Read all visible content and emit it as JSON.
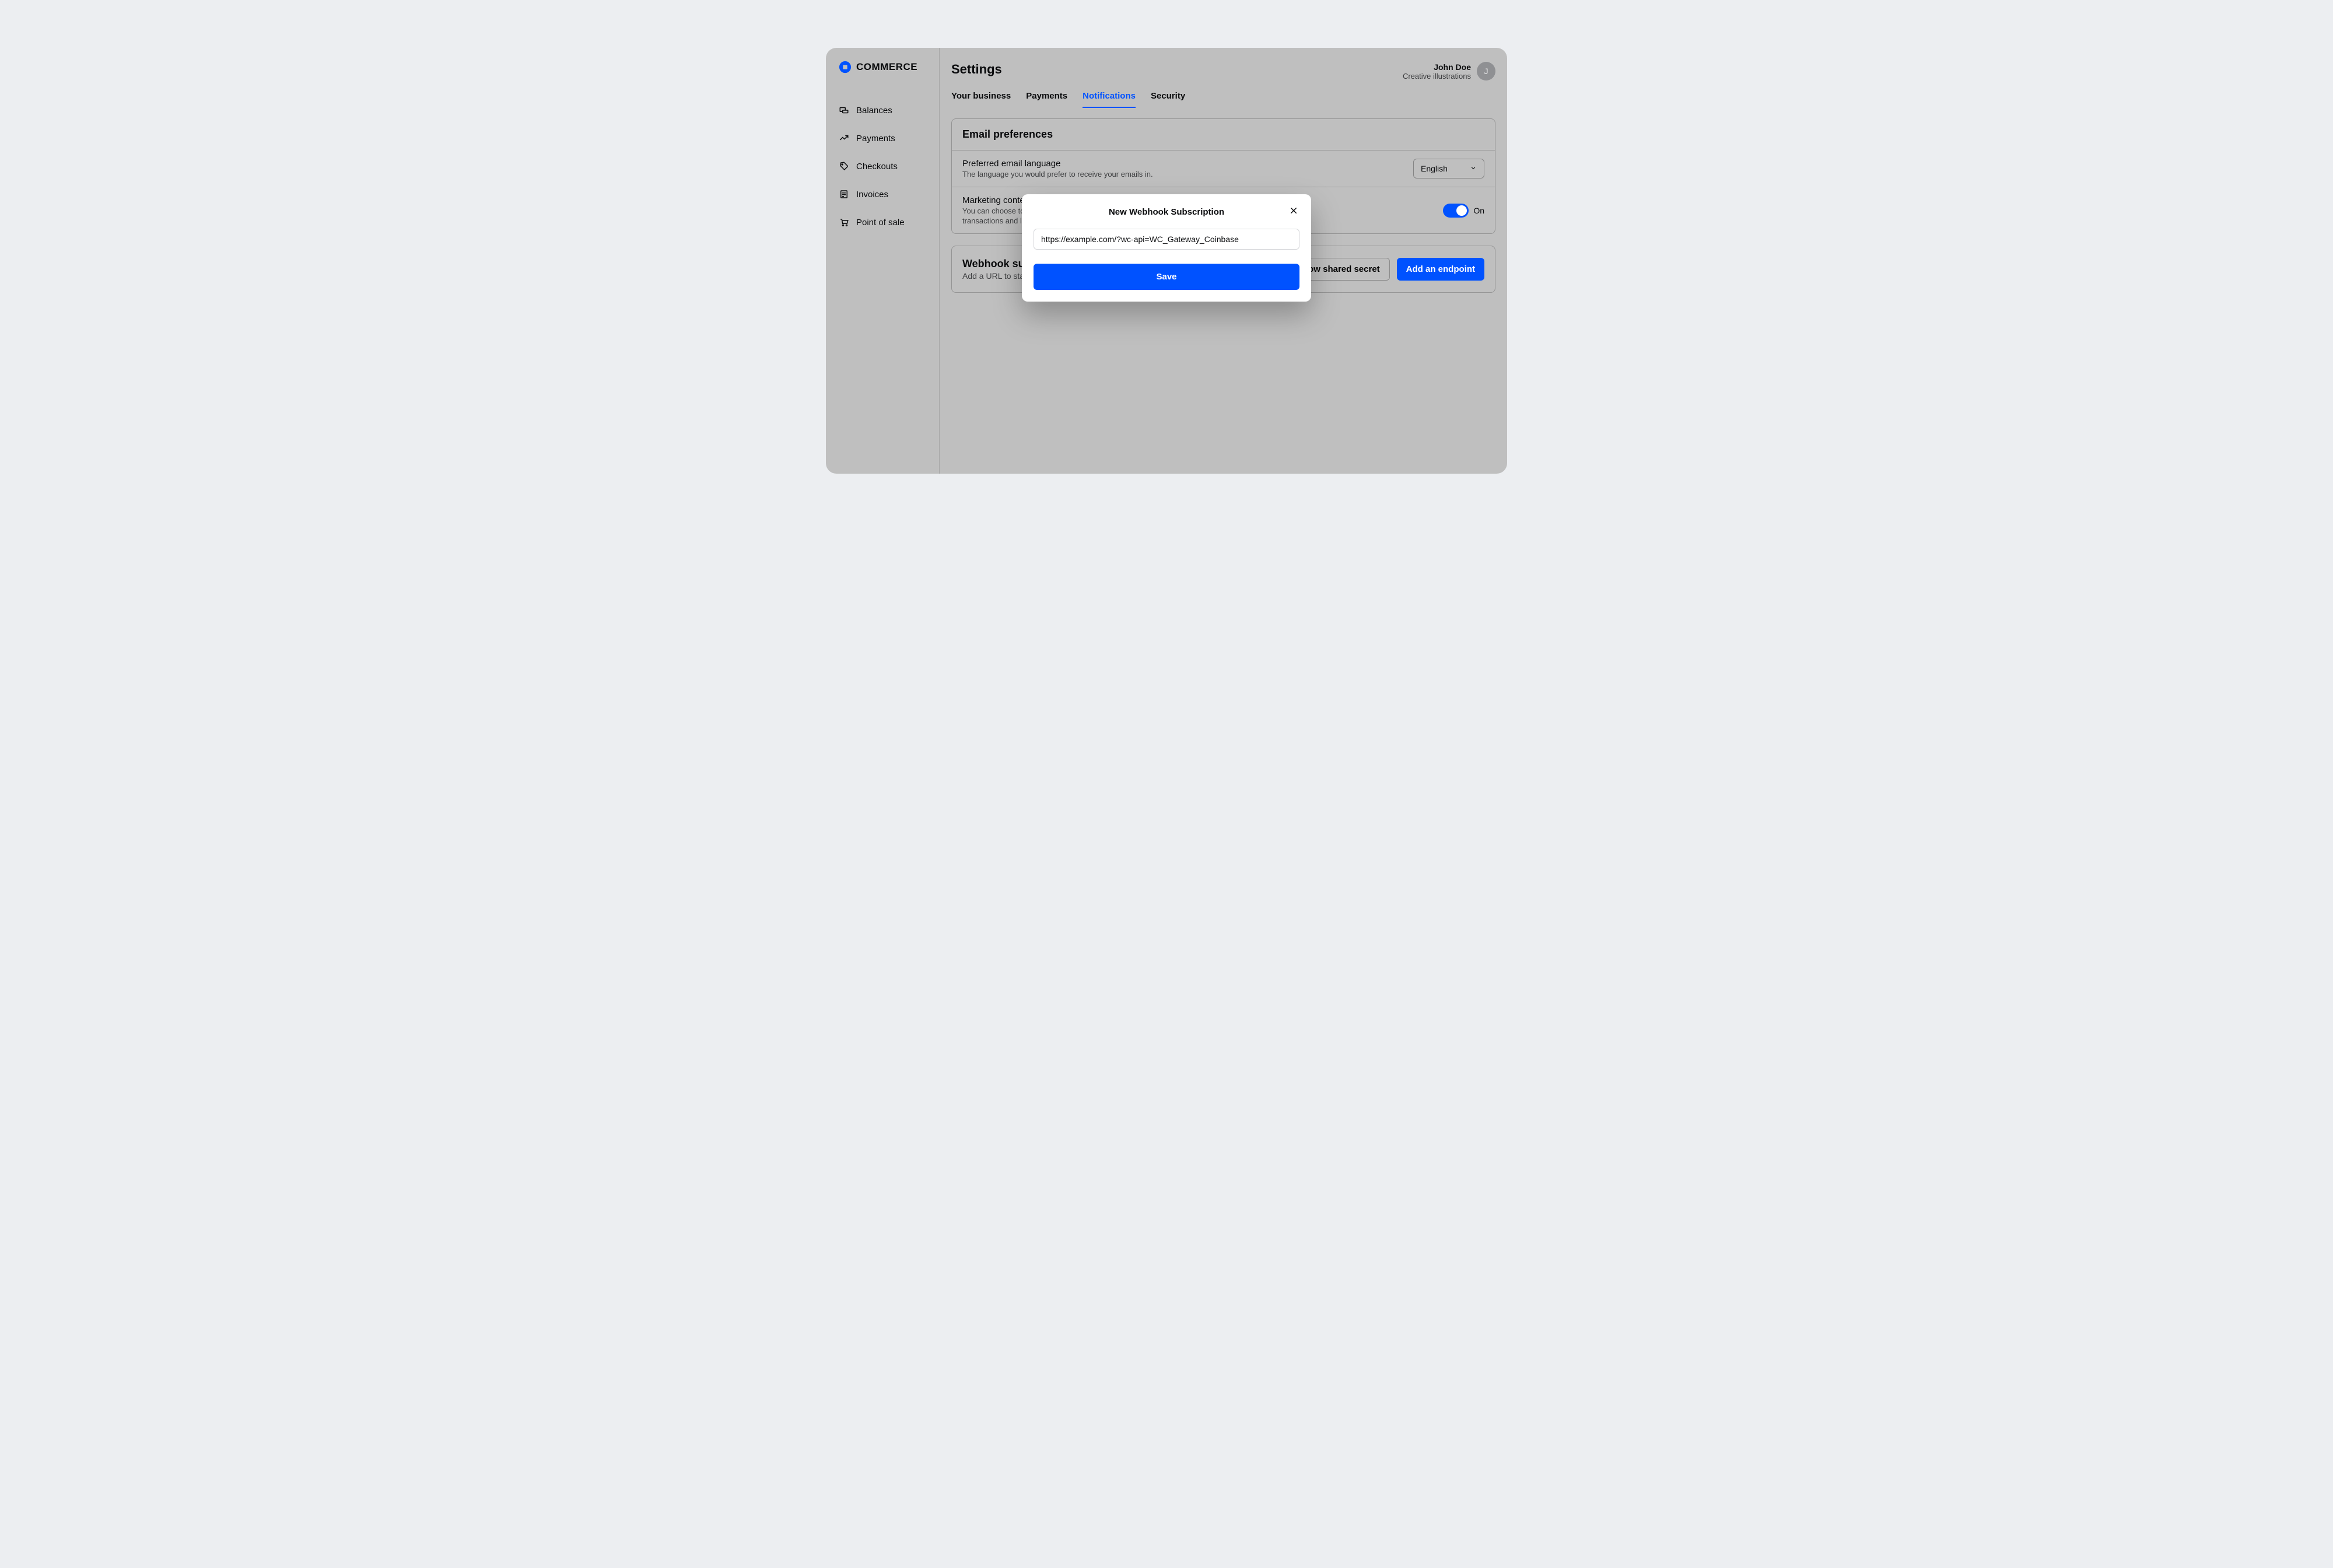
{
  "brand": {
    "name": "COMMERCE"
  },
  "sidebar": {
    "items": [
      {
        "label": "Balances"
      },
      {
        "label": "Payments"
      },
      {
        "label": "Checkouts"
      },
      {
        "label": "Invoices"
      },
      {
        "label": "Point of sale"
      }
    ]
  },
  "header": {
    "page_title": "Settings",
    "user_name": "John Doe",
    "org_name": "Creative illustrations",
    "avatar_initial": "J"
  },
  "tabs": [
    {
      "label": "Your business",
      "active": false
    },
    {
      "label": "Payments",
      "active": false
    },
    {
      "label": "Notifications",
      "active": true
    },
    {
      "label": "Security",
      "active": false
    }
  ],
  "email_prefs": {
    "section_title": "Email preferences",
    "language_row": {
      "title": "Preferred email language",
      "subtitle": "The language you would prefer to receive your emails in.",
      "selected": "English"
    },
    "marketing_row": {
      "title": "Marketing content",
      "subtitle_partial_visible": "You can choose to o",
      "subtitle_partial_visible_2": "transactions and le",
      "toggle_state": "On"
    }
  },
  "webhook": {
    "section_title_partial": "Webhook sub",
    "subtitle_partial": "Add a URL to sta",
    "show_secret_label": "Show shared secret",
    "add_endpoint_label": "Add an endpoint"
  },
  "modal": {
    "title": "New Webhook Subscription",
    "url_value": "https://example.com/?wc-api=WC_Gateway_Coinbase",
    "save_label": "Save"
  },
  "colors": {
    "accent": "#0052ff",
    "page_bg": "#eceef1",
    "panel_bg_dimmed": "#bfbfbf"
  }
}
